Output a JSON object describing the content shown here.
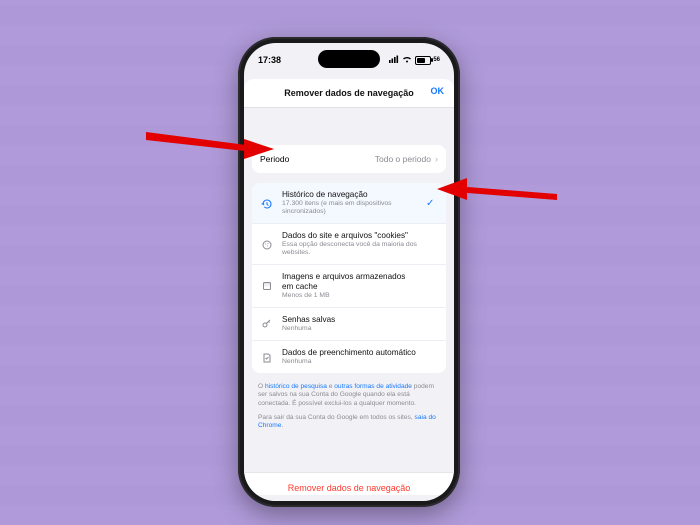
{
  "status": {
    "time": "17:38",
    "battery_pct": "56"
  },
  "sheet": {
    "title": "Remover dados de navegação",
    "ok_label": "OK"
  },
  "period": {
    "label": "Periodo",
    "value": "Todo o periodo"
  },
  "items": [
    {
      "icon": "history-icon",
      "title": "Histórico de navegação",
      "subtitle": "17.300 itens (e mais em dispositivos sincronizados)",
      "selected": true
    },
    {
      "icon": "cookie-icon",
      "title": "Dados do site e arquivos \"cookies\"",
      "subtitle": "Essa opção desconecta você da maioria dos websites.",
      "selected": false
    },
    {
      "icon": "cache-icon",
      "title": "Imagens e arquivos armazenados em cache",
      "subtitle": "Menos de 1 MB",
      "selected": false
    },
    {
      "icon": "key-icon",
      "title": "Senhas salvas",
      "subtitle": "Nenhuma",
      "selected": false
    },
    {
      "icon": "autofill-icon",
      "title": "Dados de preenchimento automático",
      "subtitle": "Nenhuma",
      "selected": false
    }
  ],
  "footer": {
    "note1_pre": "O ",
    "note1_link1": "histórico de pesquisa",
    "note1_mid": " e ",
    "note1_link2": "outras formas de atividade",
    "note1_post": " podem ser salvos na sua Conta do Google quando ela está conectada. É possível exclui-los a qualquer momento.",
    "note2_pre": "Para sair da sua Conta do Google em todos os sites, ",
    "note2_link": "saia do Chrome",
    "note2_post": "."
  },
  "action": {
    "remove_label": "Remover dados de navegação"
  },
  "icon_color": {
    "muted": "#8a8a92",
    "accent": "#1778ff"
  }
}
